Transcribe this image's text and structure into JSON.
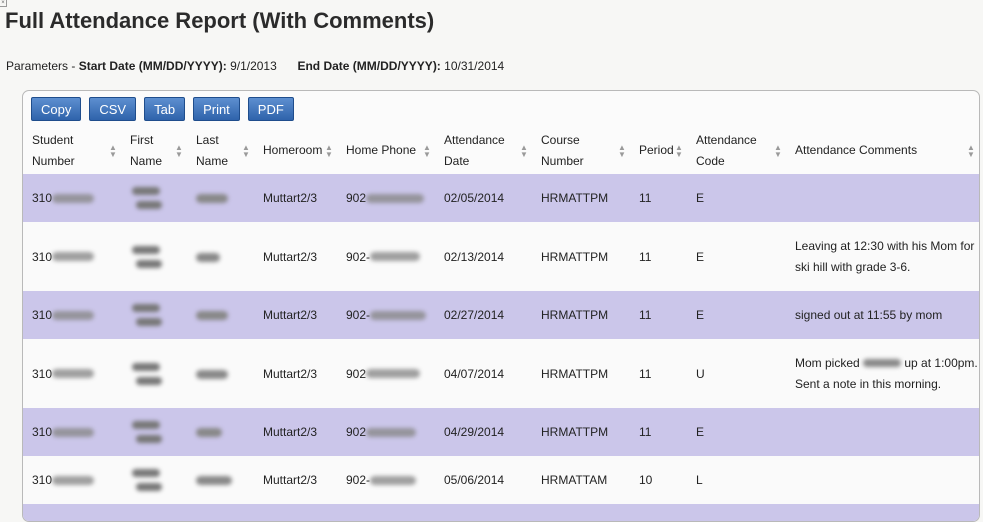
{
  "report": {
    "title": "Full Attendance Report (With Comments)",
    "params_prefix": "Parameters -",
    "start_label": "Start Date (MM/DD/YYYY):",
    "start_value": "9/1/2013",
    "end_label": "End Date (MM/DD/YYYY):",
    "end_value": "10/31/2014"
  },
  "toolbar": {
    "copy": "Copy",
    "csv": "CSV",
    "tab": "Tab",
    "print": "Print",
    "pdf": "PDF"
  },
  "table": {
    "headers": {
      "student_number_1": "Student",
      "student_number_2": "Number",
      "first_name_1": "First",
      "first_name_2": "Name",
      "last_name_1": "Last",
      "last_name_2": "Name",
      "homeroom": "Homeroom",
      "home_phone": "Home Phone",
      "attendance_date_1": "Attendance",
      "attendance_date_2": "Date",
      "course_number_1": "Course",
      "course_number_2": "Number",
      "period": "Period",
      "attendance_code_1": "Attendance",
      "attendance_code_2": "Code",
      "attendance_comments": "Attendance Comments"
    },
    "rows": [
      {
        "student_prefix": "310",
        "homeroom": "Muttart2/3",
        "phone_prefix": "902",
        "date": "02/05/2014",
        "course": "HRMATTPM",
        "period": "11",
        "code": "E",
        "comment": ""
      },
      {
        "student_prefix": "310",
        "homeroom": "Muttart2/3",
        "phone_prefix": "902-",
        "date": "02/13/2014",
        "course": "HRMATTPM",
        "period": "11",
        "code": "E",
        "comment": "Leaving at 12:30 with his Mom for ski hill with grade 3-6."
      },
      {
        "student_prefix": "310",
        "homeroom": "Muttart2/3",
        "phone_prefix": "902-",
        "date": "02/27/2014",
        "course": "HRMATTPM",
        "period": "11",
        "code": "E",
        "comment": "signed out at 11:55 by mom"
      },
      {
        "student_prefix": "310",
        "homeroom": "Muttart2/3",
        "phone_prefix": "902",
        "date": "04/07/2014",
        "course": "HRMATTPM",
        "period": "11",
        "code": "U",
        "comment_a": "Mom picked",
        "comment_b": "up at 1:00pm. Sent a note in this morning."
      },
      {
        "student_prefix": "310",
        "homeroom": "Muttart2/3",
        "phone_prefix": "902",
        "date": "04/29/2014",
        "course": "HRMATTPM",
        "period": "11",
        "code": "E",
        "comment": ""
      },
      {
        "student_prefix": "310",
        "homeroom": "Muttart2/3",
        "phone_prefix": "902-",
        "date": "05/06/2014",
        "course": "HRMATTAM",
        "period": "10",
        "code": "L",
        "comment": ""
      }
    ]
  },
  "icons": {
    "sort": "sort-both-icon"
  }
}
